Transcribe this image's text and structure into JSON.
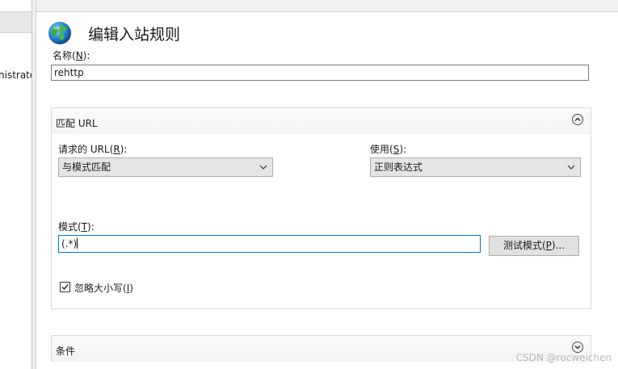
{
  "left_pane": {
    "truncated_text": "nistrato"
  },
  "page": {
    "title": "编辑入站规则"
  },
  "name_field": {
    "label": "名称(",
    "mnemonic": "N",
    "label_end": "):",
    "value": "rehttp"
  },
  "match_url": {
    "header": "匹配 URL",
    "requested_url": {
      "label": "请求的 URL(",
      "mnemonic": "R",
      "label_end": "):",
      "value": "与模式匹配"
    },
    "using": {
      "label": "使用(",
      "mnemonic": "S",
      "label_end": "):",
      "value": "正则表达式"
    },
    "pattern": {
      "label": "模式(",
      "mnemonic": "T",
      "label_end": "):",
      "value": "(.*)"
    },
    "test_button": {
      "label": "测试模式(",
      "mnemonic": "P",
      "label_end": ")..."
    },
    "ignore_case": {
      "label": "忽略大小写(",
      "mnemonic": "I",
      "label_end": ")",
      "checked": true
    }
  },
  "conditions": {
    "header": "条件"
  },
  "watermark": "CSDN @rocweichen",
  "colors": {
    "focus_border": "#0078d7",
    "combo_bg": "#e5e5e5",
    "button_bg": "#e1e1e1"
  }
}
